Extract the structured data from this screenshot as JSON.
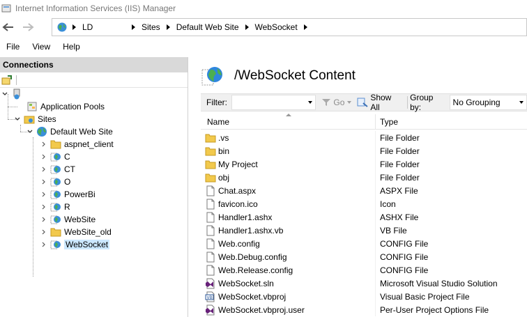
{
  "window": {
    "title": "Internet Information Services (IIS) Manager"
  },
  "address": {
    "segments": [
      "LD",
      "Sites",
      "Default Web Site",
      "WebSocket"
    ]
  },
  "menu": {
    "items": [
      "File",
      "View",
      "Help"
    ]
  },
  "connections": {
    "header": "Connections",
    "tree": [
      {
        "label": "",
        "kind": "server"
      },
      {
        "label": "Application Pools",
        "kind": "apppools"
      },
      {
        "label": "Sites",
        "kind": "sites"
      },
      {
        "label": "Default Web Site",
        "kind": "globe"
      },
      {
        "label": "aspnet_client",
        "kind": "folder"
      },
      {
        "label": "C",
        "kind": "app"
      },
      {
        "label": "CT",
        "kind": "app"
      },
      {
        "label": "O",
        "kind": "app"
      },
      {
        "label": "PowerBi",
        "kind": "app"
      },
      {
        "label": "R",
        "kind": "app"
      },
      {
        "label": "WebSite",
        "kind": "app"
      },
      {
        "label": "WebSite_old",
        "kind": "folder"
      },
      {
        "label": "WebSocket",
        "kind": "app",
        "selected": true
      }
    ]
  },
  "content": {
    "title": "/WebSocket Content",
    "filter": {
      "label": "Filter:",
      "go_label": "Go",
      "show_all_label": "Show All",
      "group_by_label": "Group by:",
      "group_by_value": "No Grouping"
    },
    "columns": {
      "name": "Name",
      "type": "Type"
    },
    "rows": [
      {
        "name": ".vs",
        "type": "File Folder",
        "icon": "folder"
      },
      {
        "name": "bin",
        "type": "File Folder",
        "icon": "folder"
      },
      {
        "name": "My Project",
        "type": "File Folder",
        "icon": "folder"
      },
      {
        "name": "obj",
        "type": "File Folder",
        "icon": "folder"
      },
      {
        "name": "Chat.aspx",
        "type": "ASPX File",
        "icon": "file"
      },
      {
        "name": "favicon.ico",
        "type": "Icon",
        "icon": "file"
      },
      {
        "name": "Handler1.ashx",
        "type": "ASHX File",
        "icon": "file"
      },
      {
        "name": "Handler1.ashx.vb",
        "type": "VB File",
        "icon": "file"
      },
      {
        "name": "Web.config",
        "type": "CONFIG File",
        "icon": "file"
      },
      {
        "name": "Web.Debug.config",
        "type": "CONFIG File",
        "icon": "file"
      },
      {
        "name": "Web.Release.config",
        "type": "CONFIG File",
        "icon": "file"
      },
      {
        "name": "WebSocket.sln",
        "type": "Microsoft Visual Studio Solution",
        "icon": "vs"
      },
      {
        "name": "WebSocket.vbproj",
        "type": "Visual Basic Project File",
        "icon": "vb"
      },
      {
        "name": "WebSocket.vbproj.user",
        "type": "Per-User Project Options File",
        "icon": "vs"
      }
    ]
  },
  "colors": {
    "selection": "#cce8ff",
    "folder": "#f2c94c",
    "globe": "#2e86de",
    "header_bg": "#d9d9d9"
  }
}
